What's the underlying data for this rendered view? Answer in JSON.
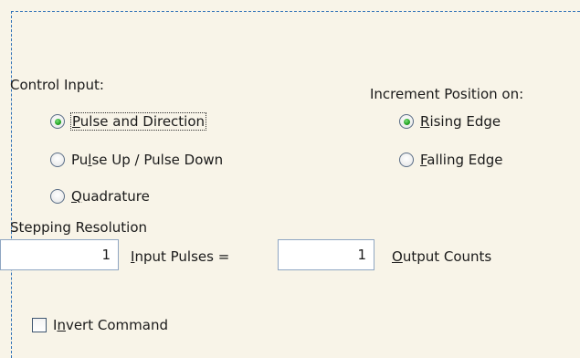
{
  "control_input": {
    "label": "Control Input:",
    "options": [
      {
        "pre": "",
        "key": "P",
        "post": "ulse and Direction",
        "selected": true,
        "focused": true
      },
      {
        "pre": "Pu",
        "key": "l",
        "post": "se Up / Pulse Down",
        "selected": false,
        "focused": false
      },
      {
        "pre": "",
        "key": "Q",
        "post": "uadrature",
        "selected": false,
        "focused": false
      }
    ]
  },
  "increment_position": {
    "label": "Increment Position on:",
    "options": [
      {
        "pre": "",
        "key": "R",
        "post": "ising Edge",
        "selected": true
      },
      {
        "pre": "",
        "key": "F",
        "post": "alling Edge",
        "selected": false
      }
    ]
  },
  "stepping": {
    "label": "Stepping Resolution",
    "input_pulses_value": "1",
    "input_pulses_label_key": "I",
    "input_pulses_label_rest": "nput Pulses =",
    "output_counts_value": "1",
    "output_counts_label_key": "O",
    "output_counts_label_rest": "utput Counts"
  },
  "invert": {
    "pre": "I",
    "key": "n",
    "post": "vert Command",
    "checked": false
  },
  "colors": {
    "background": "#f8f4e8",
    "dashed_border": "#2b6fb6",
    "radio_selected": "#22a322"
  }
}
